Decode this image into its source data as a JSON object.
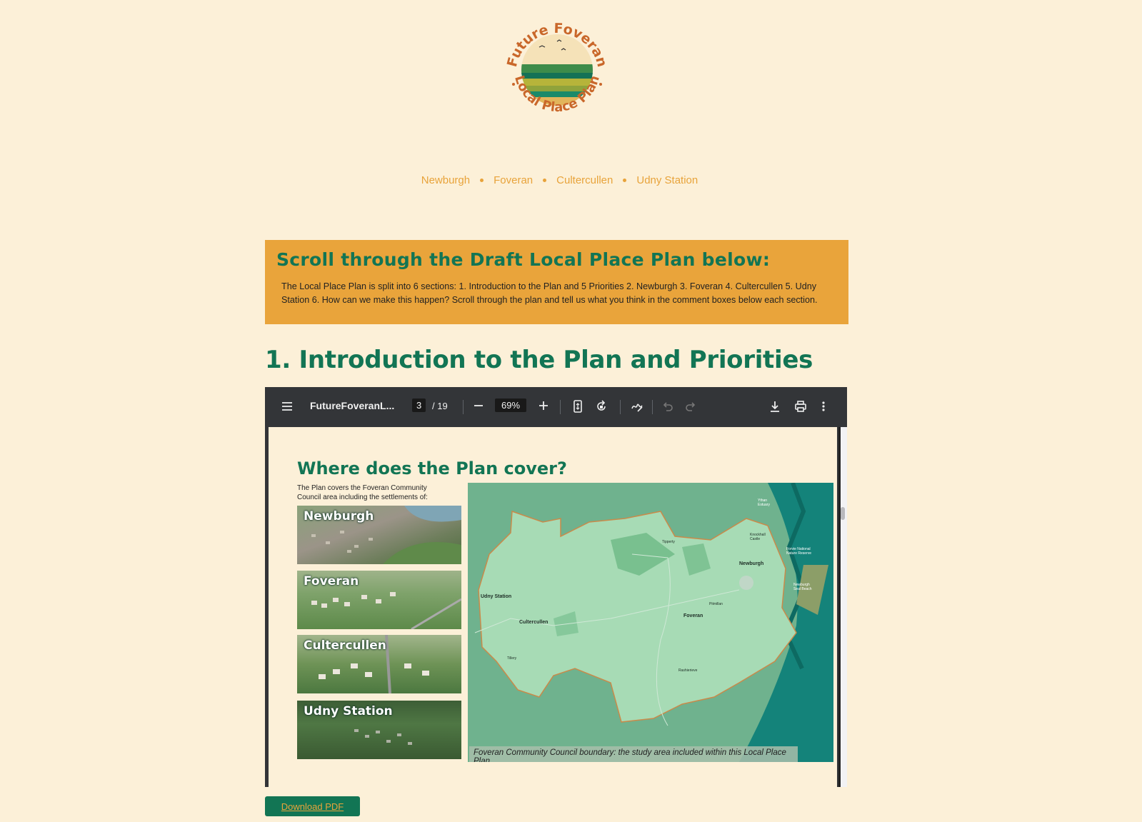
{
  "logo": {
    "text_top": "Future Foveran",
    "text_bottom": "Local Place Plan"
  },
  "nav": {
    "items": [
      "Newburgh",
      "Foveran",
      "Cultercullen",
      "Udny Station"
    ]
  },
  "banner": {
    "title": "Scroll through the Draft Local Place Plan below:",
    "description": "The Local Place Plan is split into 6 sections:  1. Introduction to the Plan and 5 Priorities 2. Newburgh 3. Foveran 4. Cultercullen 5. Udny Station 6. How can we make this happen? Scroll through the plan and tell us what you think in the comment boxes below each section."
  },
  "section": {
    "title": "1. Introduction to the Plan and Priorities"
  },
  "viewer": {
    "filename": "FutureFoveranL...",
    "current_page": "3",
    "total_pages": "/ 19",
    "zoom": "69%",
    "icons": [
      "menu-icon",
      "minus-icon",
      "plus-icon",
      "fit-page-icon",
      "rotate-icon",
      "annotate-icon",
      "undo-icon",
      "redo-icon",
      "download-icon",
      "print-icon",
      "more-icon"
    ]
  },
  "document": {
    "title": "Where does the Plan cover?",
    "intro": "The Plan covers the Foveran Community Council area including the settlements of:",
    "photos": [
      "Newburgh",
      "Foveran",
      "Cultercullen",
      "Udny Station"
    ],
    "map_caption": "Foveran Community Council boundary: the study area included within this Local Place Plan.",
    "map_labels": {
      "udny": "Udny Station",
      "culter": "Cultercullen",
      "foveran": "Foveran",
      "newburgh": "Newburgh",
      "pitmillan": "Pitmillan",
      "tipperty": "Tipperty",
      "tillery": "Tillery",
      "rashierieve": "Rashierieve",
      "forvie": "Forvie National Nature Reserve",
      "ythan": "Ythan Estuary",
      "beach": "Newburgh Seal Beach",
      "knockhall": "Knockhall Castle"
    }
  },
  "download": {
    "label": "Download PDF"
  },
  "colors": {
    "background": "#fcf0d8",
    "accent_orange": "#e9a43b",
    "brand_green": "#127554",
    "viewer_dark": "#333538"
  }
}
